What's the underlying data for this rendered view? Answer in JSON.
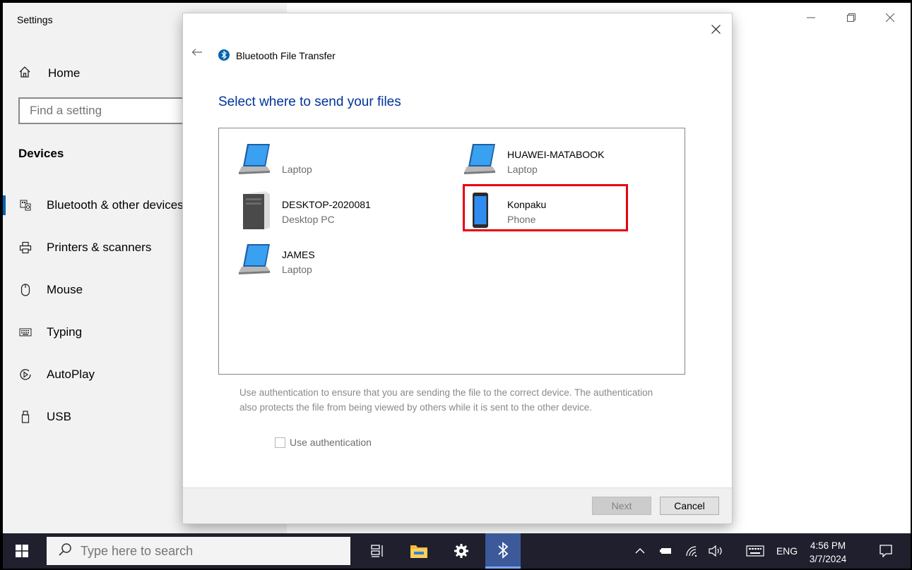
{
  "settings": {
    "title": "Settings",
    "home_label": "Home",
    "search_placeholder": "Find a setting",
    "section_heading": "Devices",
    "nav_items": [
      {
        "label": "Bluetooth & other devices",
        "icon": "bluetooth-devices-icon"
      },
      {
        "label": "Printers & scanners",
        "icon": "printer-icon"
      },
      {
        "label": "Mouse",
        "icon": "mouse-icon"
      },
      {
        "label": "Typing",
        "icon": "keyboard-icon"
      },
      {
        "label": "AutoPlay",
        "icon": "autoplay-icon"
      },
      {
        "label": "USB",
        "icon": "usb-icon"
      }
    ]
  },
  "dialog": {
    "title": "Bluetooth File Transfer",
    "heading": "Select where to send your files",
    "devices": [
      {
        "name": "",
        "type": "Laptop",
        "icon": "laptop-icon"
      },
      {
        "name": "HUAWEI-MATABOOK",
        "type": "Laptop",
        "icon": "laptop-icon"
      },
      {
        "name": "DESKTOP-2020081",
        "type": "Desktop PC",
        "icon": "desktop-pc-icon"
      },
      {
        "name": "Konpaku",
        "type": "Phone",
        "icon": "phone-icon"
      },
      {
        "name": "JAMES",
        "type": "Laptop",
        "icon": "laptop-icon"
      }
    ],
    "auth_description": "Use authentication to ensure that you are sending the file to the correct device. The authentication also protects the file from being viewed by others while it is sent to the other device.",
    "auth_checkbox_label": "Use authentication",
    "next_label": "Next",
    "cancel_label": "Cancel"
  },
  "taskbar": {
    "search_placeholder": "Type here to search",
    "language": "ENG",
    "time": "4:56 PM",
    "date": "3/7/2024"
  },
  "colors": {
    "accent": "#0063b1",
    "heading_blue": "#003399",
    "highlight_red": "#e8000b",
    "taskbar": "#1f1f2e"
  }
}
